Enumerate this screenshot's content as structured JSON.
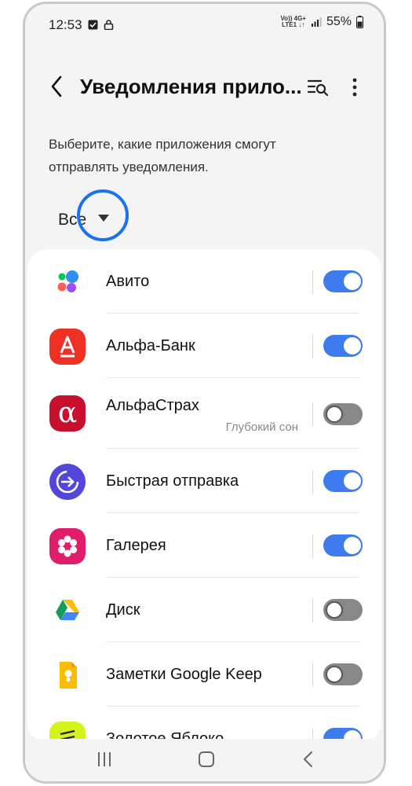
{
  "status_bar": {
    "time": "12:53",
    "network_top": "Vo)) 4G+",
    "network_bottom": "LTE1 ↓↑",
    "battery": "55%"
  },
  "header": {
    "title": "Уведомления прило..."
  },
  "subtitle": "Выберите, какие приложения смогут отправлять уведомления.",
  "filter": {
    "label": "Все"
  },
  "accent_color": "#3e7bef",
  "apps": [
    {
      "name": "Авито",
      "subtitle": "",
      "enabled": true,
      "icon": "avito-icon"
    },
    {
      "name": "Альфа-Банк",
      "subtitle": "",
      "enabled": true,
      "icon": "alfa-bank-icon"
    },
    {
      "name": "АльфаСтрах",
      "subtitle": "Глубокий сон",
      "enabled": false,
      "icon": "alfastrah-icon"
    },
    {
      "name": "Быстрая отправка",
      "subtitle": "",
      "enabled": true,
      "icon": "quick-share-icon"
    },
    {
      "name": "Галерея",
      "subtitle": "",
      "enabled": true,
      "icon": "gallery-icon"
    },
    {
      "name": "Диск",
      "subtitle": "",
      "enabled": false,
      "icon": "google-drive-icon"
    },
    {
      "name": "Заметки Google Keep",
      "subtitle": "",
      "enabled": false,
      "icon": "google-keep-icon"
    },
    {
      "name": "Золотое Яблоко",
      "subtitle": "",
      "enabled": true,
      "icon": "zolotoe-yabloko-icon"
    }
  ]
}
